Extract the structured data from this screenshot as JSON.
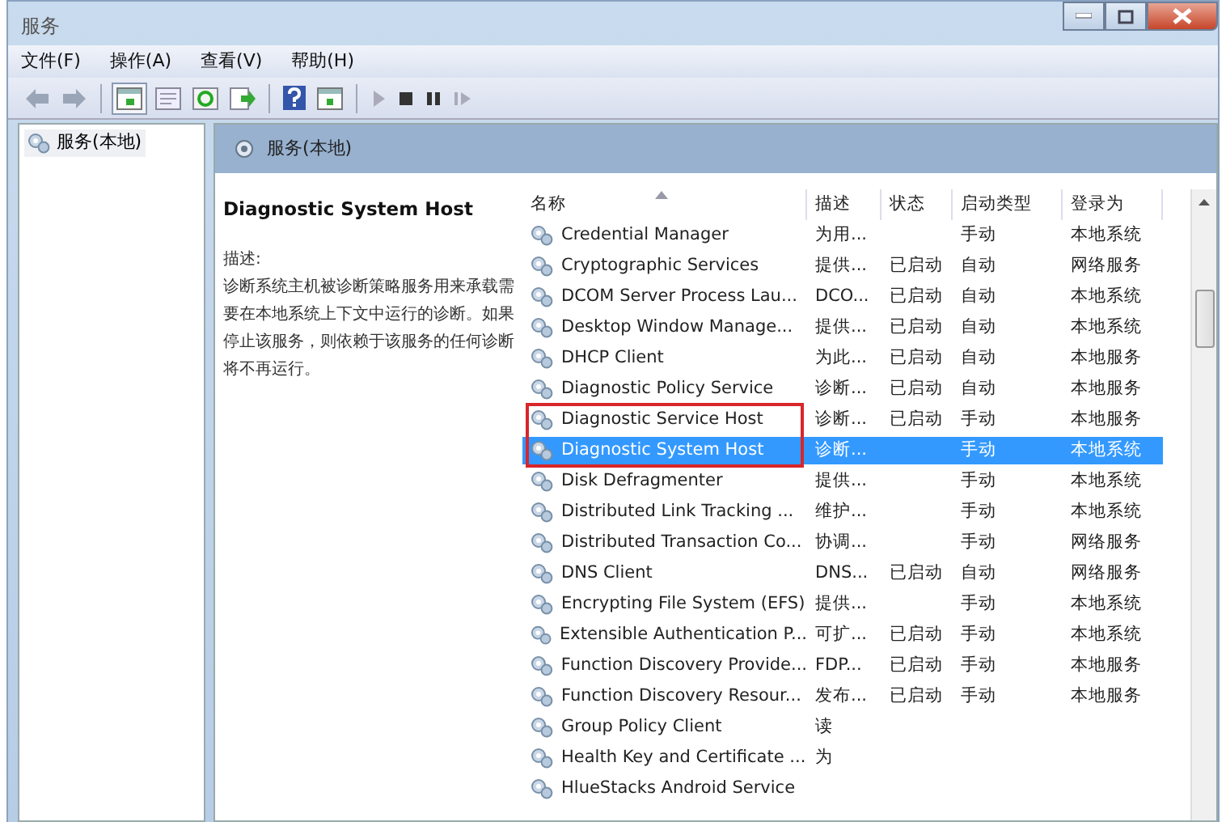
{
  "window": {
    "title": "服务"
  },
  "menu": [
    "文件(F)",
    "操作(A)",
    "查看(V)",
    "帮助(H)"
  ],
  "tree": {
    "items": [
      {
        "label": "服务(本地)",
        "selected": true
      }
    ]
  },
  "panel_header": "服务(本地)",
  "details": {
    "title": "Diagnostic System Host",
    "label": "描述:",
    "text": "诊断系统主机被诊断策略服务用来承载需要在本地系统上下文中运行的诊断。如果停止该服务，则依赖于该服务的任何诊断将不再运行。"
  },
  "table": {
    "columns": [
      "名称",
      "描述",
      "状态",
      "启动类型",
      "登录为"
    ],
    "rows": [
      {
        "name": "Credential Manager",
        "desc": "为用...",
        "status": "",
        "startup": "手动",
        "logon": "本地系统",
        "selected": false,
        "boxed": false
      },
      {
        "name": "Cryptographic Services",
        "desc": "提供...",
        "status": "已启动",
        "startup": "自动",
        "logon": "网络服务",
        "selected": false,
        "boxed": false
      },
      {
        "name": "DCOM Server Process Lau...",
        "desc": "DCO...",
        "status": "已启动",
        "startup": "自动",
        "logon": "本地系统",
        "selected": false,
        "boxed": false
      },
      {
        "name": "Desktop Window Manage...",
        "desc": "提供...",
        "status": "已启动",
        "startup": "自动",
        "logon": "本地系统",
        "selected": false,
        "boxed": false
      },
      {
        "name": "DHCP Client",
        "desc": "为此...",
        "status": "已启动",
        "startup": "自动",
        "logon": "本地服务",
        "selected": false,
        "boxed": false
      },
      {
        "name": "Diagnostic Policy Service",
        "desc": "诊断...",
        "status": "已启动",
        "startup": "自动",
        "logon": "本地服务",
        "selected": false,
        "boxed": false
      },
      {
        "name": "Diagnostic Service Host",
        "desc": "诊断...",
        "status": "已启动",
        "startup": "手动",
        "logon": "本地服务",
        "selected": false,
        "boxed": true
      },
      {
        "name": "Diagnostic System Host",
        "desc": "诊断...",
        "status": "",
        "startup": "手动",
        "logon": "本地系统",
        "selected": true,
        "boxed": true
      },
      {
        "name": "Disk Defragmenter",
        "desc": "提供...",
        "status": "",
        "startup": "手动",
        "logon": "本地系统",
        "selected": false,
        "boxed": false
      },
      {
        "name": "Distributed Link Tracking ...",
        "desc": "维护...",
        "status": "",
        "startup": "手动",
        "logon": "本地系统",
        "selected": false,
        "boxed": false
      },
      {
        "name": "Distributed Transaction Co...",
        "desc": "协调...",
        "status": "",
        "startup": "手动",
        "logon": "网络服务",
        "selected": false,
        "boxed": false
      },
      {
        "name": "DNS Client",
        "desc": "DNS...",
        "status": "已启动",
        "startup": "自动",
        "logon": "网络服务",
        "selected": false,
        "boxed": false
      },
      {
        "name": "Encrypting File System (EFS)",
        "desc": "提供...",
        "status": "",
        "startup": "手动",
        "logon": "本地系统",
        "selected": false,
        "boxed": false
      },
      {
        "name": "Extensible Authentication P...",
        "desc": "可扩...",
        "status": "已启动",
        "startup": "手动",
        "logon": "本地系统",
        "selected": false,
        "boxed": false
      },
      {
        "name": "Function Discovery Provide...",
        "desc": "FDP...",
        "status": "已启动",
        "startup": "手动",
        "logon": "本地服务",
        "selected": false,
        "boxed": false
      },
      {
        "name": "Function Discovery Resour...",
        "desc": "发布...",
        "status": "已启动",
        "startup": "手动",
        "logon": "本地服务",
        "selected": false,
        "boxed": false
      },
      {
        "name": "Group Policy Client",
        "desc": "读",
        "status": "",
        "startup": "",
        "logon": "",
        "selected": false,
        "boxed": false
      },
      {
        "name": "Health Key and Certificate ...",
        "desc": "为",
        "status": "",
        "startup": "",
        "logon": "",
        "selected": false,
        "boxed": false
      },
      {
        "name": "HlueStacks Android Service",
        "desc": "",
        "status": "",
        "startup": "",
        "logon": "",
        "selected": false,
        "boxed": false
      }
    ]
  }
}
